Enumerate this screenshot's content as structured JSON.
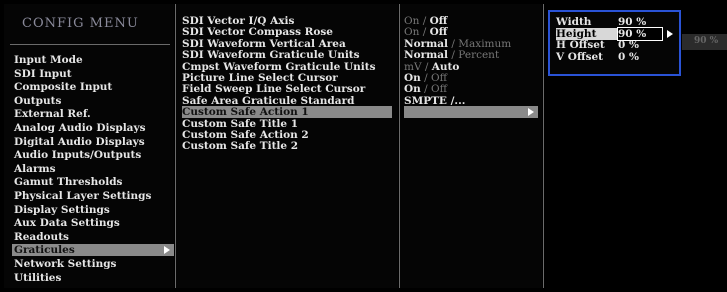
{
  "config": {
    "title": "CONFIG MENU",
    "items": [
      "Input Mode",
      "SDI Input",
      "Composite Input",
      "Outputs",
      "External Ref.",
      "Analog Audio Displays",
      "Digital Audio Displays",
      "Audio Inputs/Outputs",
      "Alarms",
      "Gamut Thresholds",
      "Physical Layer Settings",
      "Display Settings",
      "Aux Data Settings",
      "Readouts",
      "Graticules",
      "Network Settings",
      "Utilities"
    ],
    "selected_index": 14
  },
  "submenu": {
    "items": [
      "SDI Vector I/Q Axis",
      "SDI Vector Compass Rose",
      "SDI Waveform Vertical Area",
      "SDI Waveform Graticule Units",
      "Cmpst Waveform Graticule Units",
      "Picture Line Select Cursor",
      "Field Sweep Line Select Cursor",
      "Safe Area Graticule Standard",
      "Custom Safe Action 1",
      "Custom Safe Title 1",
      "Custom Safe Action 2",
      "Custom Safe Title 2"
    ],
    "selected_index": 8
  },
  "values": [
    {
      "a": "On",
      "sep": " / ",
      "b": "Off",
      "active": "b"
    },
    {
      "a": "On",
      "sep": " / ",
      "b": "Off",
      "active": "b"
    },
    {
      "a": "Normal",
      "sep": " / ",
      "b": "Maximum",
      "active": "a"
    },
    {
      "a": "Normal",
      "sep": " / ",
      "b": "Percent",
      "active": "a"
    },
    {
      "a": "mV",
      "sep": " / ",
      "b": "Auto",
      "active": "b"
    },
    {
      "a": "On",
      "sep": " / ",
      "b": "Off",
      "active": "a"
    },
    {
      "a": "On",
      "sep": " / ",
      "b": "Off",
      "active": "a"
    },
    {
      "a": "SMPTE /...",
      "sep": "",
      "b": "",
      "active": "a"
    }
  ],
  "popup": {
    "rows": [
      {
        "label": "Width",
        "value": "90 %"
      },
      {
        "label": "Height",
        "value": "90 %"
      },
      {
        "label": "H Offset",
        "value": "0 %"
      },
      {
        "label": "V Offset",
        "value": "0 %"
      }
    ],
    "selected_index": 1
  },
  "fade_text": "90 %"
}
